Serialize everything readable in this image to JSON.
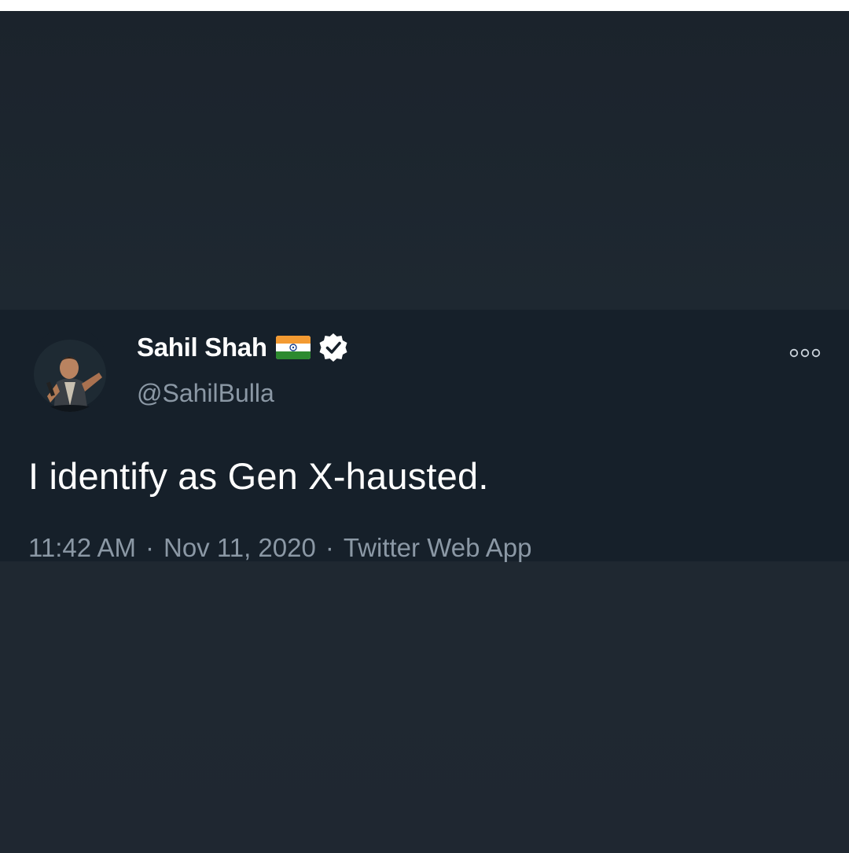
{
  "tweet": {
    "display_name": "Sahil Shah",
    "handle": "@SahilBulla",
    "flag_icon": "india-flag-icon",
    "verified_icon": "verified-badge-icon",
    "more_icon": "more-options-icon",
    "text": "I identify as Gen X-hausted.",
    "time": "11:42 AM",
    "date": "Nov 11, 2020",
    "source": "Twitter Web App",
    "separator": "·"
  },
  "colors": {
    "background": "#1e2831",
    "card": "#16202a",
    "primary_text": "#ffffff",
    "secondary_text": "#8b98a5"
  }
}
